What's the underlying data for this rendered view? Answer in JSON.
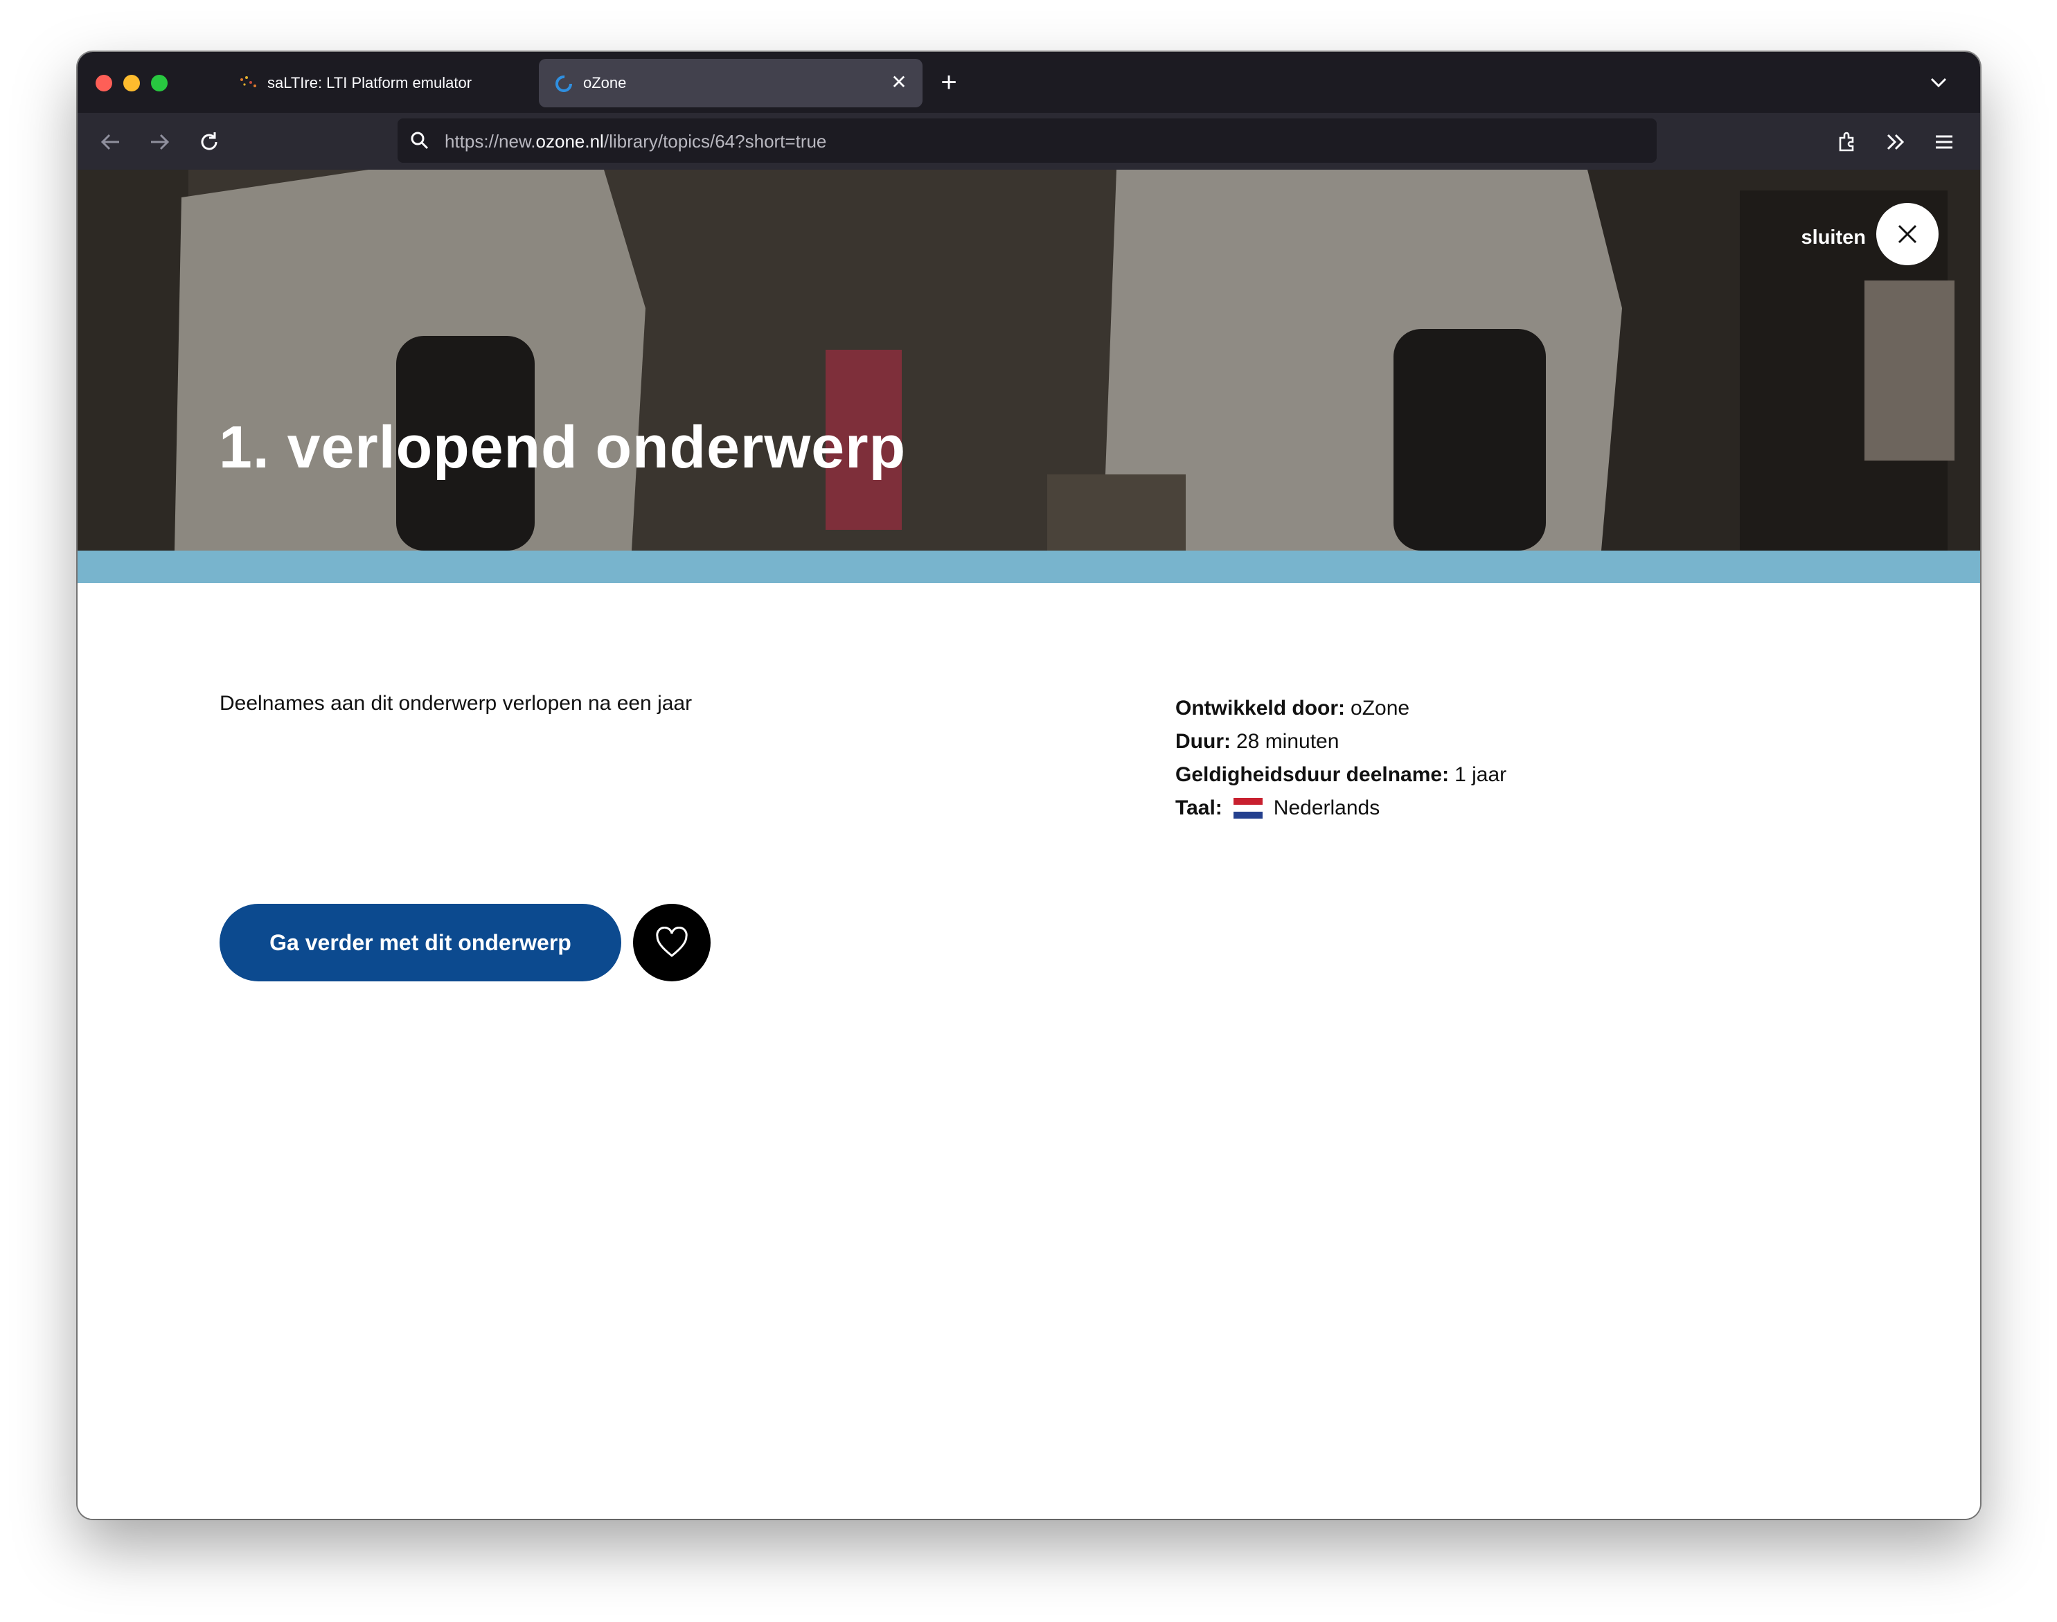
{
  "browser": {
    "tabs": [
      {
        "title": "saLTIre: LTI Platform emulator",
        "close": "✕"
      },
      {
        "title": "oZone",
        "close": "✕"
      }
    ],
    "new_tab": "+",
    "url": {
      "prefix": "https://new.",
      "host": "ozone.nl",
      "path": "/library/topics/64?short=true"
    }
  },
  "hero": {
    "title": "1. verlopend onderwerp",
    "close_label": "sluiten",
    "band_color": "#78b4cd"
  },
  "content": {
    "description": "Deelnames aan dit onderwerp verlopen na een jaar",
    "meta": [
      {
        "label": "Ontwikkeld door:",
        "value": "oZone"
      },
      {
        "label": "Duur:",
        "value": "28 minuten"
      },
      {
        "label": "Geldigheidsduur deelname:",
        "value": "1 jaar"
      },
      {
        "label": "Taal:",
        "value": "Nederlands"
      }
    ],
    "cta_label": "Ga verder met dit onderwerp",
    "primary_color": "#0c4a8f"
  },
  "icons": [
    "close-icon",
    "heart-icon",
    "flag-nl-icon",
    "back-icon",
    "forward-icon",
    "reload-icon",
    "search-icon",
    "extensions-icon",
    "overflow-icon",
    "menu-icon"
  ]
}
